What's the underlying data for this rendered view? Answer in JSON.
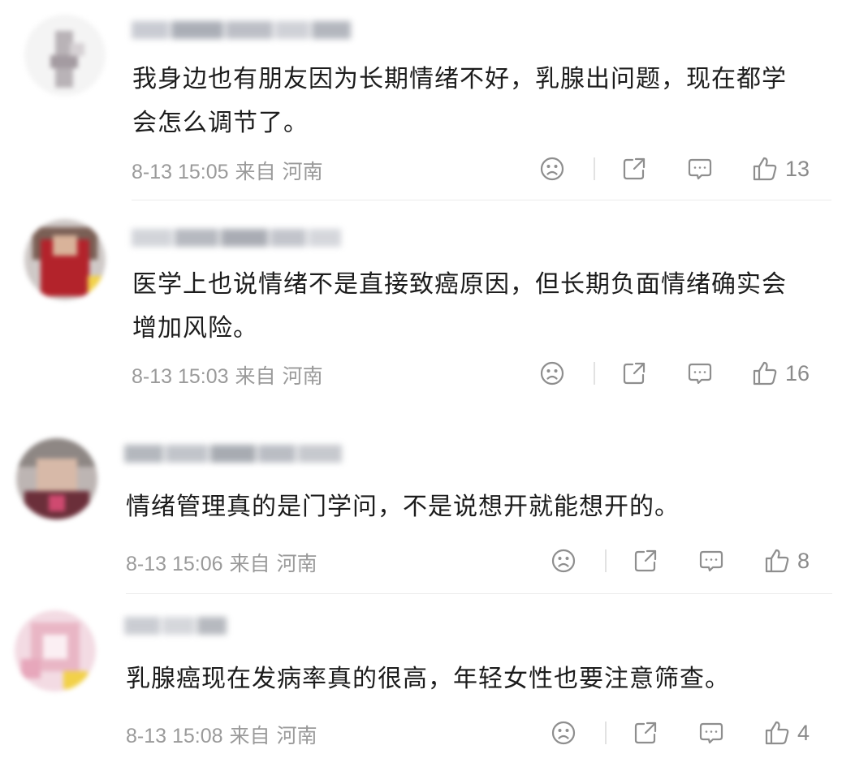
{
  "colors": {
    "text": "#1c1c1c",
    "meta": "#9a9a9a",
    "icon": "#8e8e8e",
    "divider": "#ececec"
  },
  "comments": [
    {
      "text": "我身边也有朋友因为长期情绪不好，乳腺出问题，现在都学会怎么调节了。",
      "time": "8-13 15:05",
      "source": "来自",
      "region": "河南",
      "likes": "13"
    },
    {
      "text": "医学上也说情绪不是直接致癌原因，但长期负面情绪确实会增加风险。",
      "time": "8-13 15:03",
      "source": "来自",
      "region": "河南",
      "likes": "16"
    },
    {
      "text": "情绪管理真的是门学问，不是说想开就能想开的。",
      "time": "8-13 15:06",
      "source": "来自",
      "region": "河南",
      "likes": "8"
    },
    {
      "text": "乳腺癌现在发病率真的很高，年轻女性也要注意筛查。",
      "time": "8-13 15:08",
      "source": "来自",
      "region": "河南",
      "likes": "4"
    }
  ],
  "icons": {
    "dislike": "sad-face-icon",
    "share": "share-icon",
    "reply": "comment-bubble-icon",
    "like": "thumbs-up-icon"
  }
}
